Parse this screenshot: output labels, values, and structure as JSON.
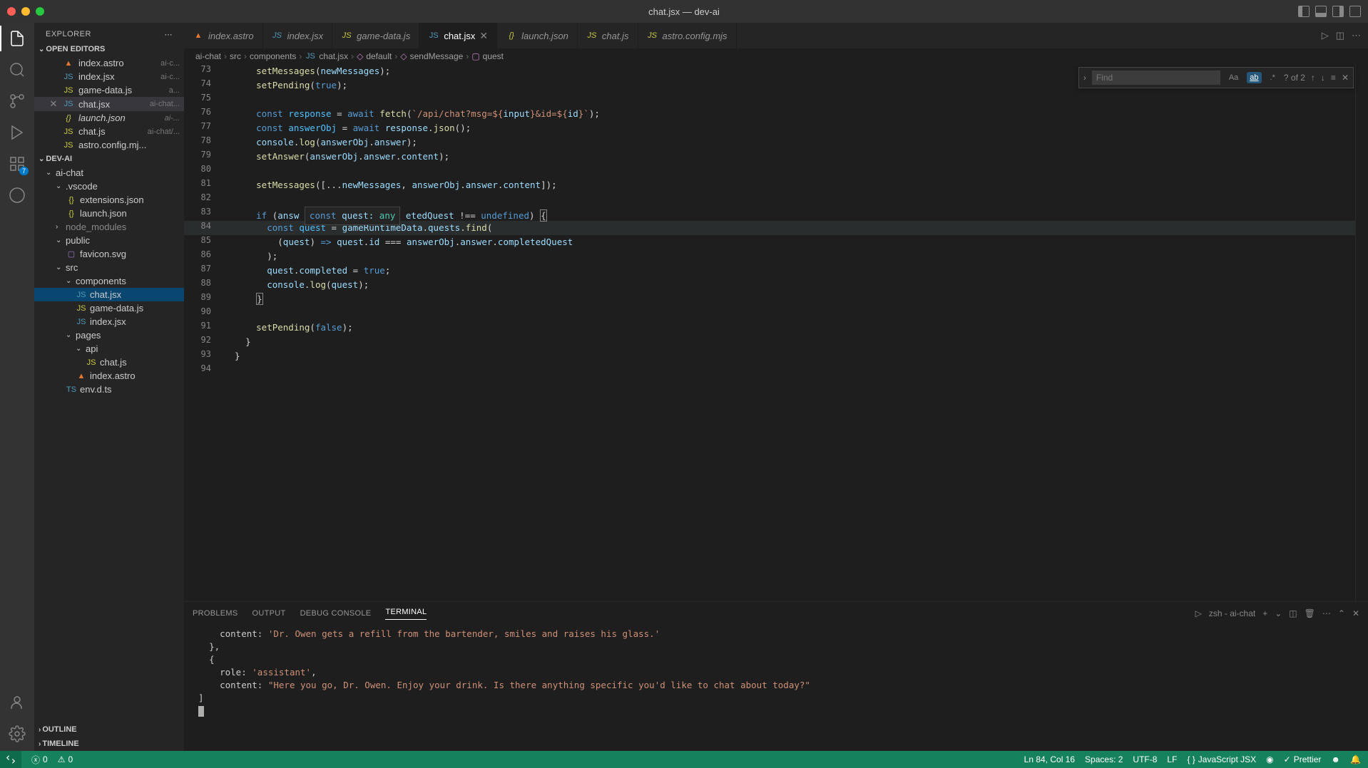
{
  "window": {
    "title": "chat.jsx — dev-ai"
  },
  "activitybar": {
    "badge": "7"
  },
  "sidebar": {
    "title": "EXPLORER",
    "openEditorsLabel": "OPEN EDITORS",
    "projectLabel": "DEV-AI",
    "outlineLabel": "OUTLINE",
    "timelineLabel": "TIMELINE",
    "openEditors": [
      {
        "name": "index.astro",
        "meta": "ai-c...",
        "icon": "astro"
      },
      {
        "name": "index.jsx",
        "meta": "ai-c...",
        "icon": "jsx"
      },
      {
        "name": "game-data.js",
        "meta": "a...",
        "icon": "js"
      },
      {
        "name": "chat.jsx",
        "meta": "ai-chat...",
        "icon": "jsx",
        "active": true
      },
      {
        "name": "launch.json",
        "meta": "ai-...",
        "icon": "json",
        "unsaved": true
      },
      {
        "name": "chat.js",
        "meta": "ai-chat/...",
        "icon": "js"
      },
      {
        "name": "astro.config.mj...",
        "meta": "",
        "icon": "js"
      }
    ],
    "tree": {
      "aichat": "ai-chat",
      "vscode": ".vscode",
      "extensions": "extensions.json",
      "launch": "launch.json",
      "node_modules": "node_modules",
      "public": "public",
      "favicon": "favicon.svg",
      "src": "src",
      "components": "components",
      "chatjsx": "chat.jsx",
      "gamedata": "game-data.js",
      "indexjsx": "index.jsx",
      "pages": "pages",
      "api": "api",
      "chatjs": "chat.js",
      "indexastro": "index.astro",
      "envdts": "env.d.ts"
    }
  },
  "tabs": [
    {
      "name": "index.astro",
      "icon": "astro"
    },
    {
      "name": "index.jsx",
      "icon": "jsx"
    },
    {
      "name": "game-data.js",
      "icon": "js"
    },
    {
      "name": "chat.jsx",
      "icon": "jsx",
      "active": true,
      "close": true
    },
    {
      "name": "launch.json",
      "icon": "json",
      "italic": true
    },
    {
      "name": "chat.js",
      "icon": "js"
    },
    {
      "name": "astro.config.mjs",
      "icon": "js"
    }
  ],
  "breadcrumb": {
    "p1": "ai-chat",
    "p2": "src",
    "p3": "components",
    "p4": "chat.jsx",
    "p5": "default",
    "p6": "sendMessage",
    "p7": "quest"
  },
  "find": {
    "placeholder": "Find",
    "count": "? of 2"
  },
  "gutter": {
    "start": 73,
    "end": 94
  },
  "code": {
    "hover": "const quest: any",
    "lines": [
      {
        "n": 73,
        "html": "      <span class='fn'>setMessages</span>(<span class='var'>newMessages</span>);"
      },
      {
        "n": 74,
        "html": "      <span class='fn'>setPending</span>(<span class='bool'>true</span>);"
      },
      {
        "n": 75,
        "html": ""
      },
      {
        "n": 76,
        "html": "      <span class='kw'>const</span> <span class='const'>response</span> = <span class='kw'>await</span> <span class='fn'>fetch</span>(<span class='tmpl'>`/api/chat?msg=${</span><span class='var'>input</span><span class='tmpl'>}&id=${</span><span class='var'>id</span><span class='tmpl'>}`</span>);"
      },
      {
        "n": 77,
        "html": "      <span class='kw'>const</span> <span class='const'>answerObj</span> = <span class='kw'>await</span> <span class='var'>response</span>.<span class='fn'>json</span>();"
      },
      {
        "n": 78,
        "html": "      <span class='var'>console</span>.<span class='fn'>log</span>(<span class='var'>answerObj</span>.<span class='prop'>answer</span>);"
      },
      {
        "n": 79,
        "html": "      <span class='fn'>setAnswer</span>(<span class='var'>answerObj</span>.<span class='prop'>answer</span>.<span class='prop'>content</span>);"
      },
      {
        "n": 80,
        "html": ""
      },
      {
        "n": 81,
        "html": "      <span class='fn'>setMessages</span>([...<span class='var'>newMessages</span>, <span class='var'>answerObj</span>.<span class='prop'>answer</span>.<span class='prop'>content</span>]);"
      },
      {
        "n": 82,
        "html": ""
      },
      {
        "n": 83,
        "html": "      <span class='kw'>if</span> (<span class='var'>answ</span> <span class='hover-box'><span class='kw'>const</span> <span class='var'>quest</span>: <span class='type'>any</span></span> <span class='prop'>etedQuest</span> !== <span class='bool'>undefined</span>) <span class='brace-match'>{</span>"
      },
      {
        "n": 84,
        "html": "        <span class='kw'>const</span> <span class='const'>quest</span> = <span class='var'>gameRuntimeData</span>.<span class='prop'>quests</span>.<span class='fn'>find</span>(",
        "hl": true
      },
      {
        "n": 85,
        "html": "          (<span class='param'>quest</span>) <span class='kw'>=&gt;</span> <span class='var'>quest</span>.<span class='prop'>id</span> === <span class='var'>answerObj</span>.<span class='prop'>answer</span>.<span class='prop'>completedQuest</span>"
      },
      {
        "n": 86,
        "html": "        );"
      },
      {
        "n": 87,
        "html": "        <span class='var'>quest</span>.<span class='prop'>completed</span> = <span class='bool'>true</span>;"
      },
      {
        "n": 88,
        "html": "        <span class='var'>console</span>.<span class='fn'>log</span>(<span class='var'>quest</span>);"
      },
      {
        "n": 89,
        "html": "      <span class='brace-match'>}</span>"
      },
      {
        "n": 90,
        "html": ""
      },
      {
        "n": 91,
        "html": "      <span class='fn'>setPending</span>(<span class='bool'>false</span>);"
      },
      {
        "n": 92,
        "html": "    }"
      },
      {
        "n": 93,
        "html": "  }"
      },
      {
        "n": 94,
        "html": ""
      }
    ]
  },
  "panel": {
    "tabs": {
      "problems": "PROBLEMS",
      "output": "OUTPUT",
      "debug": "DEBUG CONSOLE",
      "terminal": "TERMINAL"
    },
    "shell": "zsh - ai-chat",
    "terminal": [
      {
        "t": "    content: ",
        "s": "'Dr. Owen gets a refill from the bartender, smiles and raises his glass.'"
      },
      {
        "t": "  },"
      },
      {
        "t": "  {"
      },
      {
        "t": "    role: ",
        "s": "'assistant'",
        "t2": ","
      },
      {
        "t": "    content: ",
        "s": "\"Here you go, Dr. Owen. Enjoy your drink. Is there anything specific you'd like to chat about today?\""
      },
      {
        "t": "]"
      },
      {
        "cursor": true
      }
    ]
  },
  "status": {
    "errors": "0",
    "warnings": "0",
    "position": "Ln 84, Col 16",
    "spaces": "Spaces: 2",
    "encoding": "UTF-8",
    "eol": "LF",
    "lang": "JavaScript JSX",
    "prettier": "Prettier"
  }
}
